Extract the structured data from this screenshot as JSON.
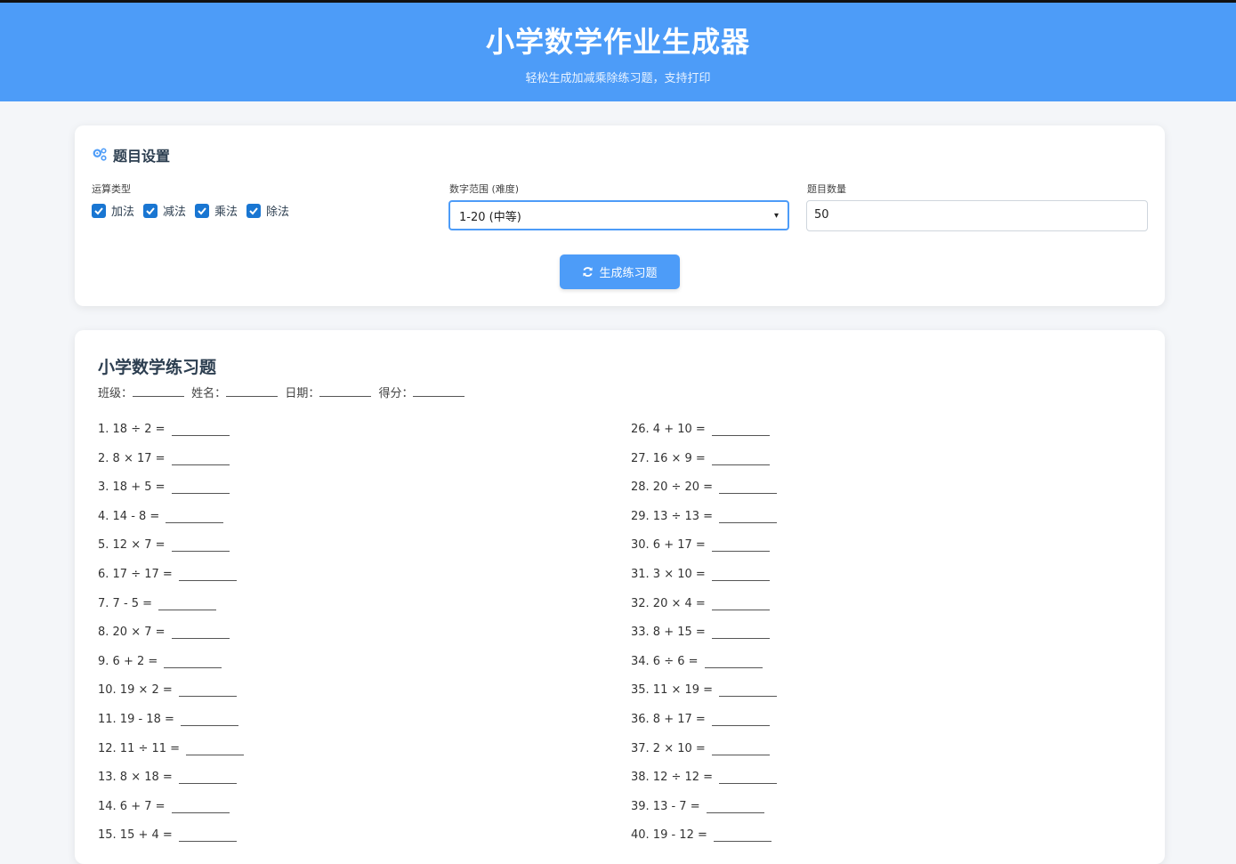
{
  "header": {
    "title": "小学数学作业生成器",
    "subtitle": "轻松生成加减乘除练习题，支持打印"
  },
  "settings": {
    "title": "题目设置",
    "op_label": "运算类型",
    "ops": [
      "加法",
      "减法",
      "乘法",
      "除法"
    ],
    "range_label": "数字范围 (难度)",
    "range_value": "1-20 (中等)",
    "count_label": "题目数量",
    "count_value": "50",
    "generate_label": "生成练习题"
  },
  "sheet": {
    "title": "小学数学练习题",
    "fields": [
      "班级：",
      "姓名：",
      "日期：",
      "得分："
    ]
  },
  "problems_left": [
    "1. 18 ÷ 2 =",
    "2. 8 × 17 =",
    "3. 18 + 5 =",
    "4. 14 - 8 =",
    "5. 12 × 7 =",
    "6. 17 ÷ 17 =",
    "7. 7 - 5 =",
    "8. 20 × 7 =",
    "9. 6 + 2 =",
    "10. 19 × 2 =",
    "11. 19 - 18 =",
    "12. 11 ÷ 11 =",
    "13. 8 × 18 =",
    "14. 6 + 7 =",
    "15. 15 + 4 ="
  ],
  "problems_right": [
    "26. 4 + 10 =",
    "27. 16 × 9 =",
    "28. 20 ÷ 20 =",
    "29. 13 ÷ 13 =",
    "30. 6 + 17 =",
    "31. 3 × 10 =",
    "32. 20 × 4 =",
    "33. 8 + 15 =",
    "34. 6 ÷ 6 =",
    "35. 11 × 19 =",
    "36. 8 + 17 =",
    "37. 2 × 10 =",
    "38. 12 ÷ 12 =",
    "39. 13 - 7 =",
    "40. 19 - 12 ="
  ],
  "colors": {
    "primary": "#4d9cf8",
    "checkbox": "#1976d2"
  }
}
